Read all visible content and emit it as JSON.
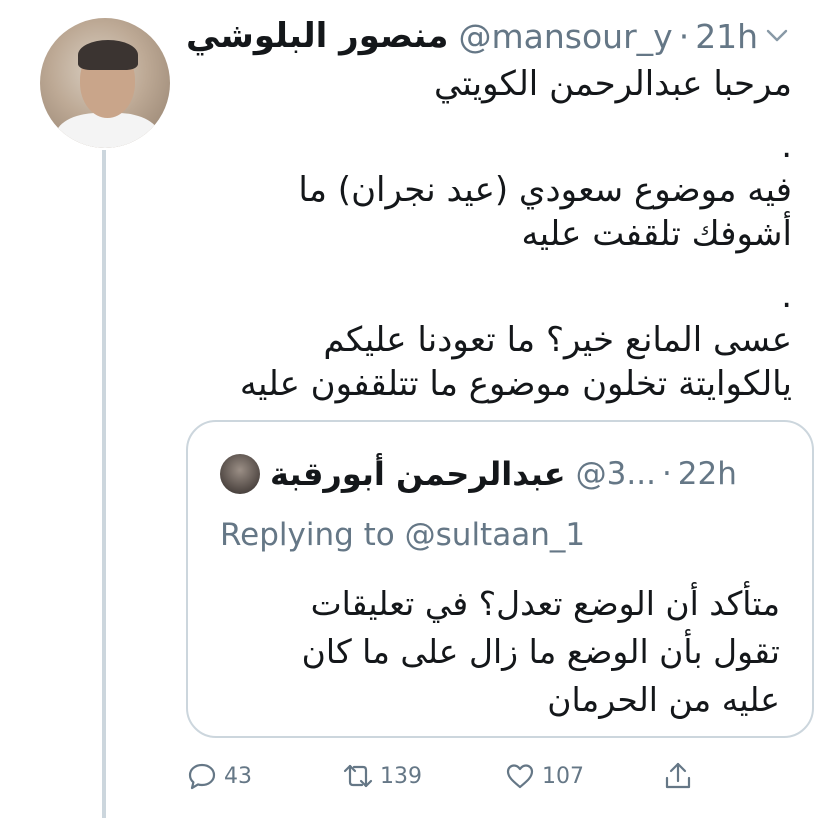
{
  "tweet": {
    "author": {
      "display_name": "منصور البلوشي",
      "handle": "@mansour_y",
      "avatar_icon": "profile-photo"
    },
    "separator": "·",
    "time": "21h",
    "menu_icon": "chevron-down-icon",
    "text_lines": [
      "مرحبا عبدالرحمن الكويتي",
      ".",
      "فيه موضوع سعودي (عيد نجران) ما",
      "أشوفك تلقفت عليه",
      ".",
      "عسى المانع خير؟ ما تعودنا عليكم",
      "يالكوايتة تخلون موضوع ما تتلقفون عليه"
    ],
    "quoted": {
      "display_name": "عبدالرحمن أبورقبة",
      "handle": "@3...",
      "separator": "·",
      "time": "22h",
      "replying_prefix": "Replying to",
      "replying_to": "@sultaan_1",
      "text_lines": [
        "متأكد أن الوضع تعدل؟ في تعليقات",
        "تقول بأن الوضع ما زال على ما كان",
        "عليه من الحرمان"
      ]
    },
    "actions": {
      "reply_count": "43",
      "retweet_count": "139",
      "like_count": "107"
    },
    "colors": {
      "secondary_text": "#657786",
      "border": "#ccd6dd",
      "primary_text": "#14171a"
    }
  }
}
